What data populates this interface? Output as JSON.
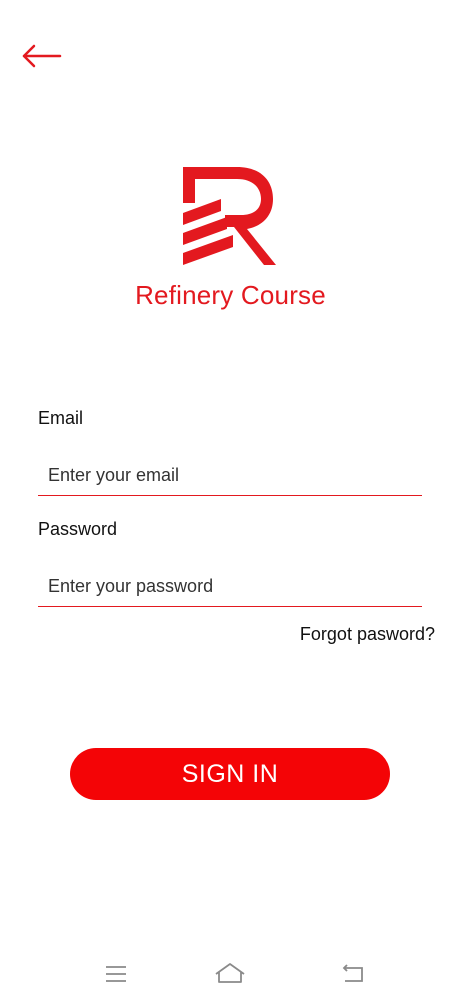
{
  "header": {
    "back_icon": "arrow-left-icon"
  },
  "brand": {
    "logo_icon": "refinery-logo-icon",
    "app_name": "Refinery Course",
    "accent_color": "#e3191f"
  },
  "form": {
    "email_label": "Email",
    "email_placeholder": "Enter your email",
    "email_value": "",
    "password_label": "Password",
    "password_placeholder": "Enter your password",
    "password_value": "",
    "forgot_password": "Forgot pasword?",
    "sign_in_label": "SIGN IN",
    "button_color": "#f40406"
  },
  "system_nav": {
    "menu_icon": "menu-icon",
    "home_icon": "home-icon",
    "back_icon": "back-icon"
  }
}
